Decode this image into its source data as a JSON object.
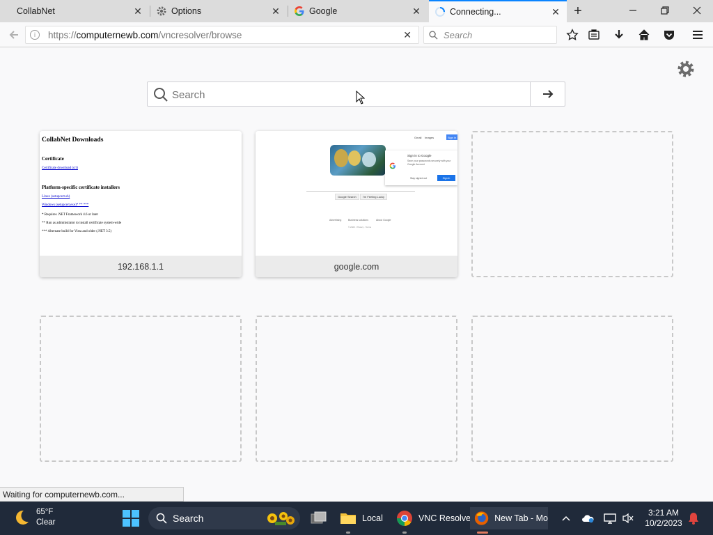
{
  "tabs": [
    {
      "label": "CollabNet",
      "icon": "none"
    },
    {
      "label": "Options",
      "icon": "gear-icon"
    },
    {
      "label": "Google",
      "icon": "google-g-icon"
    },
    {
      "label": "Connecting...",
      "icon": "loading-spinner-icon",
      "active": true
    }
  ],
  "url": {
    "scheme": "https://",
    "domain": "computernewb.com",
    "path": "/vncresolver/browse"
  },
  "search_bar": {
    "placeholder": "Search"
  },
  "newtab_search": {
    "placeholder": "Search"
  },
  "top_sites": [
    {
      "caption": "192.168.1.1"
    },
    {
      "caption": "google.com"
    }
  ],
  "collabnet_thumb": {
    "title": "CollabNet Downloads",
    "cert_heading": "Certificate",
    "cert_link": "Certificate download (crt)",
    "platform_heading": "Platform-specific certificate installers",
    "linux_link": "Linux (setupcert.sh)",
    "windows_link": "Windows (setupcert.exe)* ** ***",
    "note1": "* Requires .NET Framework 4.6 or later",
    "note2": "** Run as administrator to install certificate system-wide",
    "note3": "*** Alternate build for Vista and older (.NET 3.5)"
  },
  "google_thumb": {
    "top_links": [
      "Gmail",
      "Images"
    ],
    "signin_btn": "Sign in",
    "popup_title": "Sign in to Google",
    "popup_text": "Save your passwords securely with your Google Account",
    "popup_stay": "Stay signed out",
    "popup_signin": "Sign in",
    "btn_search": "Google Search",
    "btn_lucky": "I'm Feeling Lucky",
    "footer_links": [
      "Advertising",
      "Business solutions",
      "About Google"
    ],
    "footer_small": "© 2023 · Privacy · Terms"
  },
  "status_text": "Waiting for computernewb.com...",
  "taskbar": {
    "weather_temp": "65°F",
    "weather_cond": "Clear",
    "search_label": "Search",
    "apps": [
      "Local",
      "VNC Resolver",
      "New Tab - Mo"
    ],
    "time": "3:21 AM",
    "date": "10/2/2023"
  },
  "colors": {
    "accent": "#0a84ff",
    "taskbar": "#202a3a"
  }
}
